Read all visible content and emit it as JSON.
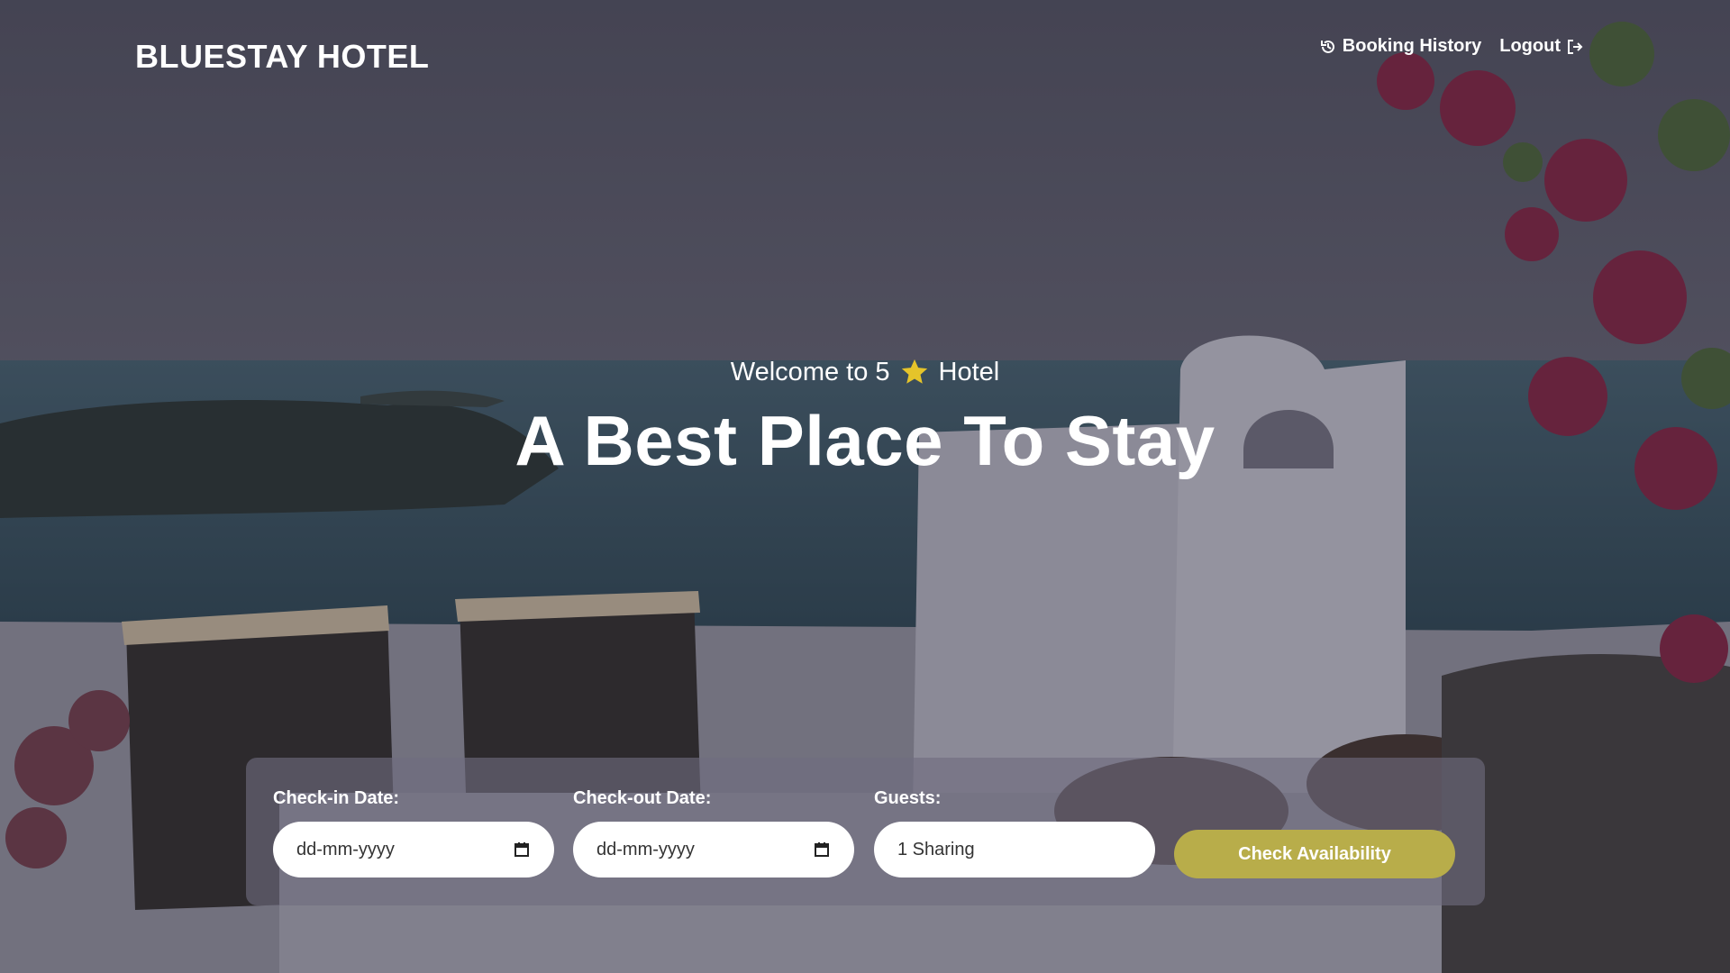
{
  "brand": "BLUESTAY HOTEL",
  "nav": {
    "history_label": "Booking History",
    "history_icon": "history-icon",
    "logout_label": "Logout",
    "logout_icon": "logout-icon"
  },
  "hero": {
    "welcome_prefix": "Welcome to 5",
    "welcome_icon": "star-icon",
    "welcome_suffix": "Hotel",
    "headline": "A Best Place To Stay"
  },
  "booking": {
    "checkin": {
      "label": "Check-in Date:",
      "value": "dd-mm-yyyy",
      "icon": "calendar-icon"
    },
    "checkout": {
      "label": "Check-out Date:",
      "value": "dd-mm-yyyy",
      "icon": "calendar-icon"
    },
    "guests": {
      "label": "Guests:",
      "value": "1 Sharing"
    },
    "button_label": "Check Availability"
  },
  "colors": {
    "accent": "#b8ad4a",
    "star": "#e5c42a",
    "panel": "#706c80"
  }
}
